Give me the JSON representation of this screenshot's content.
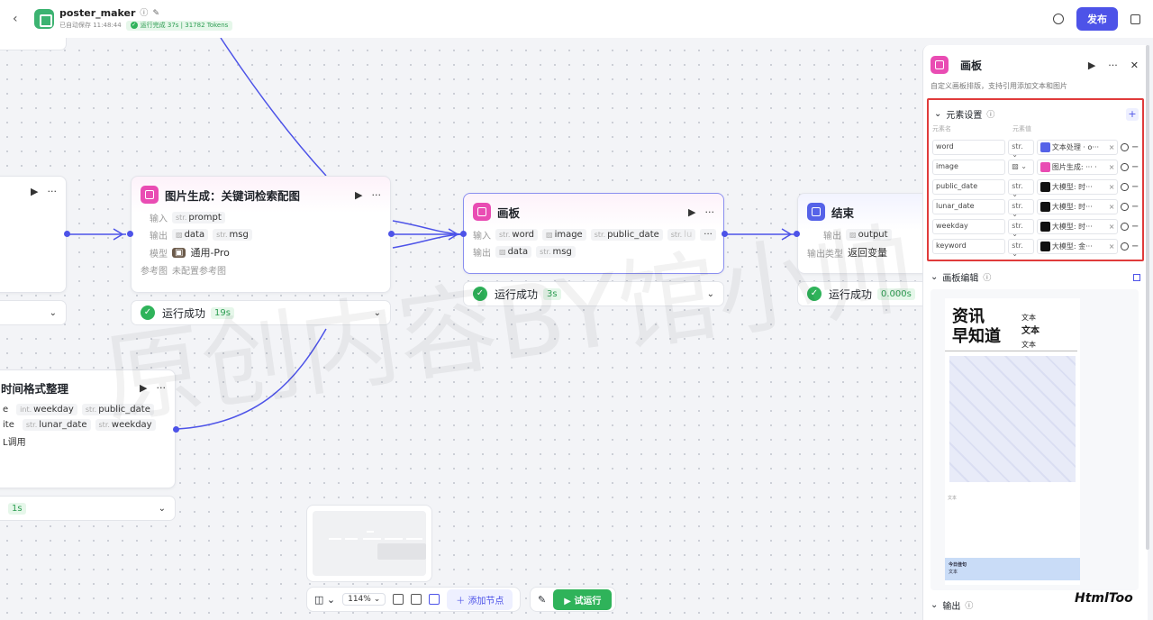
{
  "header": {
    "app_name": "poster_maker",
    "autosave": "已自动保存 11:48:44",
    "run_status": "运行完成 37s | 31782 Tokens",
    "publish": "发布"
  },
  "nodes": {
    "left_partial": {
      "result_duration": "1s"
    },
    "image_gen": {
      "title": "图片生成：关键词检索配图",
      "input_label": "输入",
      "input_tags": [
        {
          "type": "str.",
          "name": "prompt"
        }
      ],
      "output_label": "输出",
      "output_tags": [
        {
          "type": "img",
          "name": "data"
        },
        {
          "type": "str.",
          "name": "msg"
        }
      ],
      "model_label": "模型",
      "model_value": "通用-Pro",
      "ref_label": "参考图",
      "ref_value": "未配置参考图",
      "result": "运行成功",
      "duration": "19s"
    },
    "canvas": {
      "title": "画板",
      "input_label": "输入",
      "input_tags": [
        {
          "type": "str.",
          "name": "word"
        },
        {
          "type": "img",
          "name": "image"
        },
        {
          "type": "str.",
          "name": "public_date"
        },
        {
          "type": "str.",
          "name": "lu"
        }
      ],
      "output_label": "输出",
      "output_tags": [
        {
          "type": "img",
          "name": "data"
        },
        {
          "type": "str.",
          "name": "msg"
        }
      ],
      "result": "运行成功",
      "duration": "3s"
    },
    "end": {
      "title": "结束",
      "output_label": "输出",
      "output_tag": "output",
      "type_label": "输出类型",
      "type_value": "返回变量",
      "result": "运行成功",
      "duration": "0.000s"
    },
    "time_format": {
      "title": "时间格式整理",
      "row1": [
        {
          "type": "",
          "name": "e"
        },
        {
          "type": "int.",
          "name": "weekday"
        },
        {
          "type": "str.",
          "name": "public_date"
        }
      ],
      "row2": [
        {
          "type": "",
          "name": "ite"
        },
        {
          "type": "str.",
          "name": "lunar_date"
        },
        {
          "type": "str.",
          "name": "weekday"
        }
      ],
      "row3": "L调用"
    }
  },
  "watermark": "原创内容BY馆小帅",
  "toolbar": {
    "zoom": "114%",
    "add_node": "添加节点",
    "test_run": "试运行"
  },
  "panel": {
    "title": "画板",
    "description": "自定义画板排版，支持引用添加文本和图片",
    "elements_section": "元素设置",
    "col_name": "元素名",
    "col_value": "元素值",
    "elements": [
      {
        "name": "word",
        "type": "str.",
        "source": "文本处理 · o···",
        "icon": "blue"
      },
      {
        "name": "image",
        "type": "img",
        "source": "图片生成: ··· ·",
        "icon": "pink"
      },
      {
        "name": "public_date",
        "type": "str.",
        "source": "大模型: 时···",
        "icon": "black"
      },
      {
        "name": "lunar_date",
        "type": "str.",
        "source": "大模型: 时···",
        "icon": "black"
      },
      {
        "name": "weekday",
        "type": "str.",
        "source": "大模型: 时···",
        "icon": "black"
      },
      {
        "name": "keyword",
        "type": "str.",
        "source": "大模型: 金···",
        "icon": "black"
      }
    ],
    "canvas_section": "画板编辑",
    "poster": {
      "title_line1": "资讯",
      "title_line2": "早知道",
      "text_small1": "文本",
      "text_big": "文本",
      "text_small2": "文本",
      "small_text": "文本",
      "bar_title": "今日佳句",
      "bar_text": "文本"
    },
    "output_section": "输出"
  },
  "brand": "HtmlToo"
}
